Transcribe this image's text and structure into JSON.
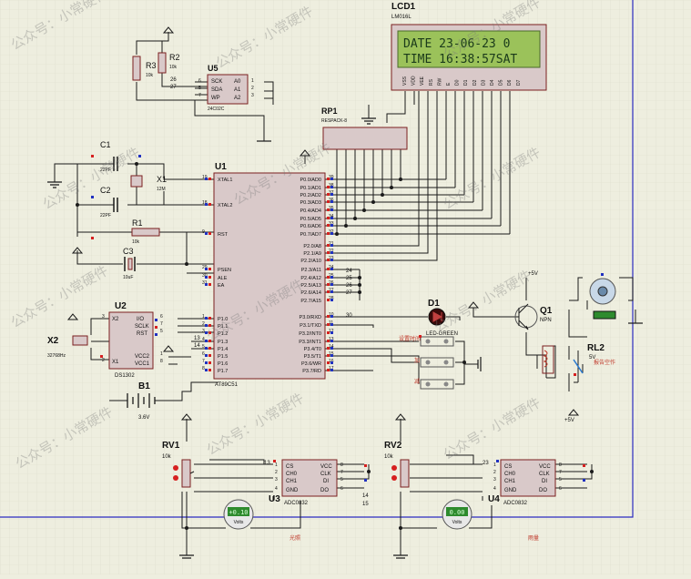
{
  "colors": {
    "background": "#eeeedf",
    "grid": "#dcdccb",
    "wire": "#1a1a1a",
    "component_outline": "#7a1f1f",
    "component_fill": "#d9c9c9",
    "lcd_bg": "#9bc25a",
    "lcd_text": "#1a3a1a",
    "pin_red": "#d62020",
    "pin_blue": "#2030c0",
    "label_red": "#c0392b",
    "power_arrow": "#1a1a1a",
    "led": "#3a0a0a",
    "sheet_border": "#2a2ac0",
    "volt_display": "#2e8b2e"
  },
  "lcd": {
    "ref": "LCD1",
    "model": "LM016L",
    "line1": "DATE 23-06-23 0",
    "line2": "TIME 16:38:57SAT",
    "pins": [
      "VSS",
      "VDD",
      "VEE",
      "RS",
      "RW",
      "E",
      "D0",
      "D1",
      "D2",
      "D3",
      "D4",
      "D5",
      "D6",
      "D7"
    ]
  },
  "rp1": {
    "ref": "RP1",
    "model": "RESPACK-8"
  },
  "u5": {
    "ref": "U5",
    "model": "24C02C",
    "pins_left": [
      "SCK",
      "SDA",
      "WP"
    ],
    "pins_right": [
      "A0",
      "A1",
      "A2"
    ],
    "pin_nums_left": [
      "6",
      "5",
      "7"
    ],
    "pin_nums_right": [
      "1",
      "2",
      "3"
    ]
  },
  "r2": {
    "ref": "R2",
    "value": "10k"
  },
  "r3": {
    "ref": "R3",
    "value": "10k"
  },
  "u5_wire_nums": [
    "26",
    "27"
  ],
  "c1": {
    "ref": "C1",
    "value": "22PF"
  },
  "c2": {
    "ref": "C2",
    "value": "22PF"
  },
  "x1": {
    "ref": "X1",
    "value": "12M"
  },
  "r1": {
    "ref": "R1",
    "value": "10k"
  },
  "c3": {
    "ref": "C3",
    "value": "10uF"
  },
  "u1": {
    "ref": "U1",
    "model": "AT89C51",
    "left_pins": [
      {
        "num": "19",
        "name": "XTAL1"
      },
      {
        "num": "18",
        "name": "XTAL2"
      },
      {
        "num": "9",
        "name": "RST"
      },
      {
        "num": "29",
        "name": "PSEN"
      },
      {
        "num": "30",
        "name": "ALE"
      },
      {
        "num": "31",
        "name": "EA"
      },
      {
        "num": "1",
        "name": "P1.0"
      },
      {
        "num": "2",
        "name": "P1.1"
      },
      {
        "num": "3",
        "name": "P1.2"
      },
      {
        "num": "4",
        "name": "P1.3"
      },
      {
        "num": "5",
        "name": "P1.4"
      },
      {
        "num": "6",
        "name": "P1.5"
      },
      {
        "num": "7",
        "name": "P1.6"
      },
      {
        "num": "8",
        "name": "P1.7"
      }
    ],
    "right_pins": [
      {
        "num": "39",
        "name": "P0.0/AD0"
      },
      {
        "num": "38",
        "name": "P0.1/AD1"
      },
      {
        "num": "37",
        "name": "P0.2/AD2"
      },
      {
        "num": "36",
        "name": "P0.3/AD3"
      },
      {
        "num": "35",
        "name": "P0.4/AD4"
      },
      {
        "num": "34",
        "name": "P0.5/AD5"
      },
      {
        "num": "33",
        "name": "P0.6/AD6"
      },
      {
        "num": "32",
        "name": "P0.7/AD7"
      },
      {
        "num": "21",
        "name": "P2.0/A8"
      },
      {
        "num": "22",
        "name": "P2.1/A9"
      },
      {
        "num": "23",
        "name": "P2.2/A10"
      },
      {
        "num": "24",
        "name": "P2.3/A11"
      },
      {
        "num": "25",
        "name": "P2.4/A12"
      },
      {
        "num": "26",
        "name": "P2.5/A13"
      },
      {
        "num": "27",
        "name": "P2.6/A14"
      },
      {
        "num": "28",
        "name": "P2.7/A15"
      },
      {
        "num": "10",
        "name": "P3.0/RXD"
      },
      {
        "num": "11",
        "name": "P3.1/TXD"
      },
      {
        "num": "12",
        "name": "P3.2/INT0"
      },
      {
        "num": "13",
        "name": "P3.3/INT1"
      },
      {
        "num": "14",
        "name": "P3.4/T0"
      },
      {
        "num": "15",
        "name": "P3.5/T1"
      },
      {
        "num": "16",
        "name": "P3.6/WR"
      },
      {
        "num": "17",
        "name": "P3.7/RD"
      }
    ],
    "p2_net_nums": [
      "24",
      "25",
      "26",
      "27"
    ],
    "p3_net_nums": [
      "30"
    ],
    "p1_net_nums": [
      "13",
      "14"
    ]
  },
  "u2": {
    "ref": "U2",
    "model": "DS1302",
    "pins_left": [
      "X2",
      "X1"
    ],
    "pins_right": [
      "I/O",
      "SCLK",
      "RST",
      "VCC2",
      "VCC1"
    ],
    "nums_left": [
      "3",
      "2"
    ],
    "nums_right": [
      "6",
      "7",
      "5",
      "1",
      "8"
    ]
  },
  "x2": {
    "ref": "X2",
    "value": "32768Hz"
  },
  "b1": {
    "ref": "B1",
    "value": "3.6V"
  },
  "d1": {
    "ref": "D1",
    "model": "LED-GREEN"
  },
  "buttons": [
    {
      "label": "设置时间"
    },
    {
      "label": "加"
    },
    {
      "label": "减"
    }
  ],
  "q1": {
    "ref": "Q1",
    "model": "NPN",
    "supply": "+5V"
  },
  "rl2": {
    "ref": "RL2",
    "value": "5V",
    "supply": "+5V"
  },
  "motor": {
    "label": "",
    "caption": "报告空作"
  },
  "rv1": {
    "ref": "RV1",
    "value": "10k"
  },
  "rv2": {
    "ref": "RV2",
    "value": "10k"
  },
  "u3": {
    "ref": "U3",
    "model": "ADC0832",
    "pins_left": [
      "CS",
      "CH0",
      "CH1",
      "GND"
    ],
    "pins_right": [
      "VCC",
      "CLK",
      "DI",
      "DO"
    ],
    "nums_left": [
      "1",
      "2",
      "3",
      "4"
    ],
    "nums_right": [
      "8",
      "7",
      "5",
      "6"
    ],
    "net_nums": [
      "13",
      "14",
      "15"
    ],
    "caption": "光照"
  },
  "u4": {
    "ref": "U4",
    "model": "ADC0832",
    "pins_left": [
      "CS",
      "CH0",
      "CH1",
      "GND"
    ],
    "pins_right": [
      "VCC",
      "CLK",
      "DI",
      "DO"
    ],
    "nums_left": [
      "1",
      "2",
      "3",
      "4"
    ],
    "nums_right": [
      "8",
      "7",
      "5",
      "6"
    ],
    "net_nums": [
      "23"
    ],
    "caption": "雨量"
  },
  "voltmeter1": {
    "reading": "+0.10",
    "unit": "Volts"
  },
  "voltmeter2": {
    "reading": "0.00",
    "unit": "Volts"
  },
  "watermark": "公众号：小常硬件"
}
